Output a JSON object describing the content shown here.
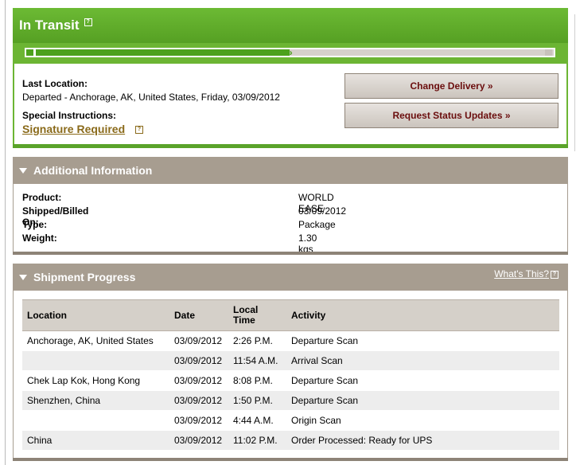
{
  "transit": {
    "title": "In Transit",
    "last_location_label": "Last Location:",
    "last_location_value": "Departed - Anchorage, AK, United States, Friday, 03/09/2012",
    "special_label": "Special Instructions:",
    "signature_link": "Signature Required",
    "change_delivery_button": "Change Delivery »",
    "request_updates_button": "Request Status Updates »",
    "progress_fraction": 0.5
  },
  "additional": {
    "title": "Additional Information",
    "rows": [
      {
        "key": "Product:",
        "value": "WORLD EASE"
      },
      {
        "key": "Shipped/Billed On:",
        "value": "03/09/2012"
      },
      {
        "key": "Type:",
        "value": "Package"
      },
      {
        "key": "Weight:",
        "value": "1.30 kgs"
      }
    ]
  },
  "shipment": {
    "title": "Shipment Progress",
    "whats_this": "What's This?",
    "columns": [
      "Location",
      "Date",
      "Local Time",
      "Activity"
    ],
    "rows": [
      {
        "location": "Anchorage, AK, United States",
        "date": "03/09/2012",
        "time": "2:26 P.M.",
        "activity": "Departure Scan"
      },
      {
        "location": "",
        "date": "03/09/2012",
        "time": "11:54 A.M.",
        "activity": "Arrival Scan"
      },
      {
        "location": "Chek Lap Kok, Hong Kong",
        "date": "03/09/2012",
        "time": "8:08 P.M.",
        "activity": "Departure Scan"
      },
      {
        "location": "Shenzhen, China",
        "date": "03/09/2012",
        "time": "1:50 P.M.",
        "activity": "Departure Scan"
      },
      {
        "location": "",
        "date": "03/09/2012",
        "time": "4:44 A.M.",
        "activity": "Origin Scan"
      },
      {
        "location": "China",
        "date": "03/09/2012",
        "time": "11:02 P.M.",
        "activity": "Order Processed: Ready for UPS"
      }
    ]
  },
  "colors": {
    "green": "#6cb533",
    "brown": "#a79d90",
    "button_text": "#6b0e0e",
    "link_gold": "#8a6a1a"
  }
}
